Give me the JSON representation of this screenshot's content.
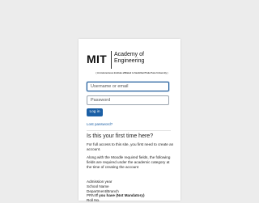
{
  "logo": {
    "short": "MIT",
    "name_line1": "Academy of",
    "name_line2": "Engineering",
    "tagline": "( An Autonomous Institute affiliated to Savitribai Phule Pune University )"
  },
  "login": {
    "username_placeholder": "Username or email",
    "password_placeholder": "Password",
    "login_label": "Log in",
    "lost_password": "Lost password?"
  },
  "first_time": {
    "heading": "Is this your first time here?",
    "intro": "For full access to this site, you first need to create an account.",
    "along": "Along with the Moodle required fields, the following fields are required under the academic category at the time of creating the account",
    "fields": [
      "Admission year",
      "School Name",
      "Department/Branch"
    ],
    "prn_prefix": "PRN ",
    "prn_bold": "If you have (Not Mandatory)",
    "roll": "Roll No."
  }
}
